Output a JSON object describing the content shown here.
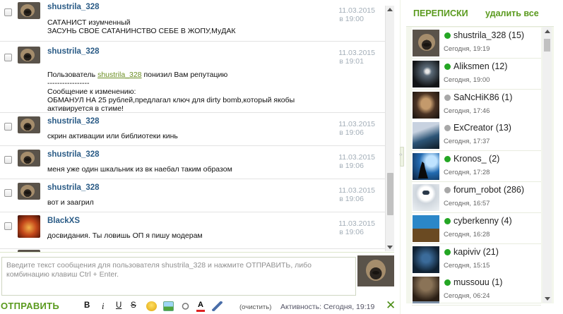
{
  "messages": [
    {
      "author": "shustrila_328",
      "avatar": "pug",
      "date": "11.03.2015",
      "time": "в 19:00",
      "text": "САТАНИСТ изумченный\nЗАСУНЬ СВОЕ САТАНИНСТВО СЕБЕ В ЖОПУ,МуДАК"
    },
    {
      "author": "shustrila_328",
      "avatar": "pug",
      "date": "11.03.2015",
      "time": "в 19:01",
      "text_prefix": "Пользователь ",
      "link": "shustrila_328",
      "text_suffix": " понизил Вам репутацию",
      "text": "-----------------\nСообщение к изменению:\nОБМАНУЛ НА 25 рублей,предлагал ключ для dirty bomb,который якобы\nактивируется в стиме!"
    },
    {
      "author": "shustrila_328",
      "avatar": "pug",
      "date": "11.03.2015",
      "time": "в 19:06",
      "text": "скрин активации или библиотеки кинь"
    },
    {
      "author": "shustrila_328",
      "avatar": "pug",
      "date": "11.03.2015",
      "time": "в 19:06",
      "text": "меня уже один шкальник из вк наебал таким образом"
    },
    {
      "author": "shustrila_328",
      "avatar": "pug",
      "date": "11.03.2015",
      "time": "в 19:06",
      "text": "вот и заагрил"
    },
    {
      "author": "BlackXS",
      "avatar": "fire",
      "date": "11.03.2015",
      "time": "в 19:06",
      "text": "досвидания. Ты ловишь ОП я пишу модерам"
    }
  ],
  "compose": {
    "placeholder": "Введите текст сообщения для пользователя shustrila_328 и нажмите ОТПРАВИТЬ, либо комбинацию клавиш Ctrl + Enter."
  },
  "toolbar": {
    "send_label": "ОТПРАВИТЬ",
    "bold": "B",
    "italic": "i",
    "underline": "U",
    "strike": "S",
    "color_letter": "A",
    "clear_label": "(очистить)",
    "activity": "Активность: Сегодня, 19:19",
    "close_glyph": "✕"
  },
  "sidebar": {
    "title": "ПЕРЕПИСКИ",
    "delete_all": "удалить все",
    "conversations": [
      {
        "name": "shustrila_328 (15)",
        "time": "Сегодня, 19:19",
        "online": true,
        "avatar": "pug"
      },
      {
        "name": "Aliksmen (12)",
        "time": "Сегодня, 19:00",
        "online": true,
        "avatar": "soldier"
      },
      {
        "name": "SaNcHiK86 (1)",
        "time": "Сегодня, 17:46",
        "online": false,
        "avatar": "face"
      },
      {
        "name": "ExCreator (13)",
        "time": "Сегодня, 17:37",
        "online": false,
        "avatar": "blue"
      },
      {
        "name": "Kronos_ (2)",
        "time": "Сегодня, 17:28",
        "online": true,
        "avatar": "wolf"
      },
      {
        "name": "forum_robot (286)",
        "time": "Сегодня, 16:57",
        "online": false,
        "avatar": "robot"
      },
      {
        "name": "cyberkenny (4)",
        "time": "Сегодня, 16:28",
        "online": true,
        "avatar": "walle"
      },
      {
        "name": "kapiviv (21)",
        "time": "Сегодня, 15:15",
        "online": true,
        "avatar": "dark"
      },
      {
        "name": "mussouu (1)",
        "time": "Сегодня, 06:24",
        "online": true,
        "avatar": "mussou"
      }
    ]
  },
  "colors": {
    "accent_green": "#5a9a1e",
    "author_blue": "#2a5b86",
    "online": "#24a624",
    "offline": "#a8a8a8"
  }
}
